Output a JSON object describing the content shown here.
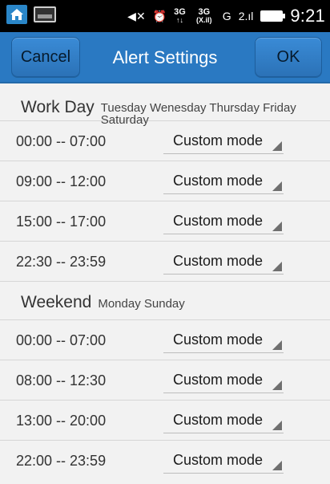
{
  "status_bar": {
    "time": "9:21",
    "network_small_top": "3G",
    "network_small_bottom": "3G\n(X.il)",
    "signal_label": "G",
    "icons": {
      "home": "home-icon",
      "gallery": "gallery-icon",
      "mute": "mute-icon",
      "alarm": "alarm-icon",
      "signal": "signal-icon",
      "battery": "battery-icon"
    }
  },
  "header": {
    "cancel_label": "Cancel",
    "title": "Alert Settings",
    "ok_label": "OK",
    "colors": {
      "bar": "#2a79c2"
    }
  },
  "work_day": {
    "label": "Work Day",
    "days": "Tuesday Wenesday Thursday Friday Saturday",
    "rows": [
      {
        "range": "00:00 -- 07:00",
        "mode": "Custom mode"
      },
      {
        "range": "09:00 -- 12:00",
        "mode": "Custom mode"
      },
      {
        "range": "15:00 -- 17:00",
        "mode": "Custom mode"
      },
      {
        "range": "22:30 -- 23:59",
        "mode": "Custom mode"
      }
    ]
  },
  "weekend": {
    "label": "Weekend",
    "days": "Monday Sunday",
    "rows": [
      {
        "range": "00:00 -- 07:00",
        "mode": "Custom mode"
      },
      {
        "range": "08:00 -- 12:30",
        "mode": "Custom mode"
      },
      {
        "range": "13:00 -- 20:00",
        "mode": "Custom mode"
      },
      {
        "range": "22:00 -- 23:59",
        "mode": "Custom mode"
      }
    ]
  }
}
